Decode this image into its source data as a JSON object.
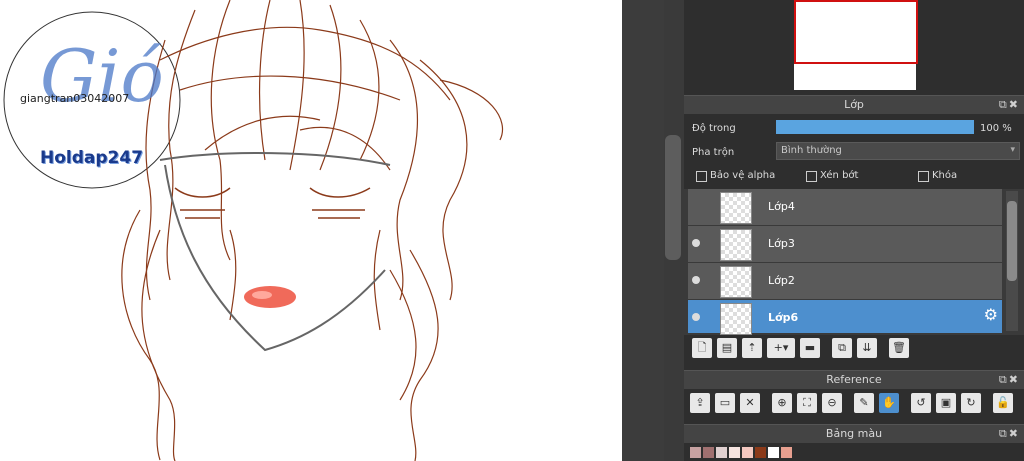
{
  "canvas": {
    "watermark_script": "Gió",
    "watermark_user": "giangtran03042007",
    "watermark_site": "Holdap247",
    "line_color": "#8b3a1a",
    "lip_color": "#f06a5a"
  },
  "layers_panel": {
    "title": "Lớp",
    "opacity_label": "Độ trong",
    "opacity_value": "100 %",
    "opacity_level": 1.0,
    "blend_label": "Pha trộn",
    "blend_value": "Bình thường",
    "protect_alpha_label": "Bảo vệ alpha",
    "clipping_label": "Xén bớt",
    "lock_label": "Khóa",
    "layers": [
      {
        "name": "Lớp4",
        "visible": false,
        "selected": false
      },
      {
        "name": "Lớp3",
        "visible": true,
        "selected": false
      },
      {
        "name": "Lớp2",
        "visible": true,
        "selected": false
      },
      {
        "name": "Lớp6",
        "visible": true,
        "selected": true
      }
    ],
    "accent_color": "#4d8fce"
  },
  "reference_panel": {
    "title": "Reference"
  },
  "palette_panel": {
    "title": "Bảng màu",
    "swatches": [
      "#c7a1a1",
      "#a07070",
      "#e0d0d0",
      "#f6e4e0",
      "#f4c8c0",
      "#8b3a1a",
      "#ffffff",
      "#e8a090"
    ]
  }
}
